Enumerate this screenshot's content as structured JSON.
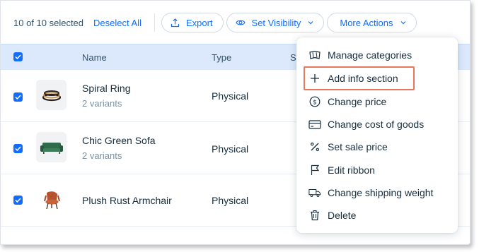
{
  "toolbar": {
    "selection_text": "10 of 10 selected",
    "deselect_label": "Deselect All",
    "export_label": "Export",
    "visibility_label": "Set Visibility",
    "more_actions_label": "More Actions"
  },
  "table": {
    "columns": [
      "Name",
      "Type",
      "S"
    ],
    "rows": [
      {
        "name": "Spiral Ring",
        "variants": "2 variants",
        "type": "Physical",
        "checked": true
      },
      {
        "name": "Chic Green Sofa",
        "variants": "2 variants",
        "type": "Physical",
        "checked": true
      },
      {
        "name": "Plush Rust Armchair",
        "variants": "",
        "type": "Physical",
        "checked": true
      }
    ]
  },
  "menu": {
    "items": [
      {
        "label": "Manage categories",
        "icon": "categories-icon"
      },
      {
        "label": "Add info section",
        "icon": "plus-icon"
      },
      {
        "label": "Change price",
        "icon": "dollar-icon"
      },
      {
        "label": "Change cost of goods",
        "icon": "card-icon"
      },
      {
        "label": "Set sale price",
        "icon": "percent-icon"
      },
      {
        "label": "Edit ribbon",
        "icon": "flag-icon"
      },
      {
        "label": "Change shipping weight",
        "icon": "truck-icon"
      },
      {
        "label": "Delete",
        "icon": "trash-icon"
      }
    ]
  },
  "colors": {
    "accent": "#116dff",
    "header_bg": "#dce9fd",
    "highlight_border": "#e8765a"
  }
}
